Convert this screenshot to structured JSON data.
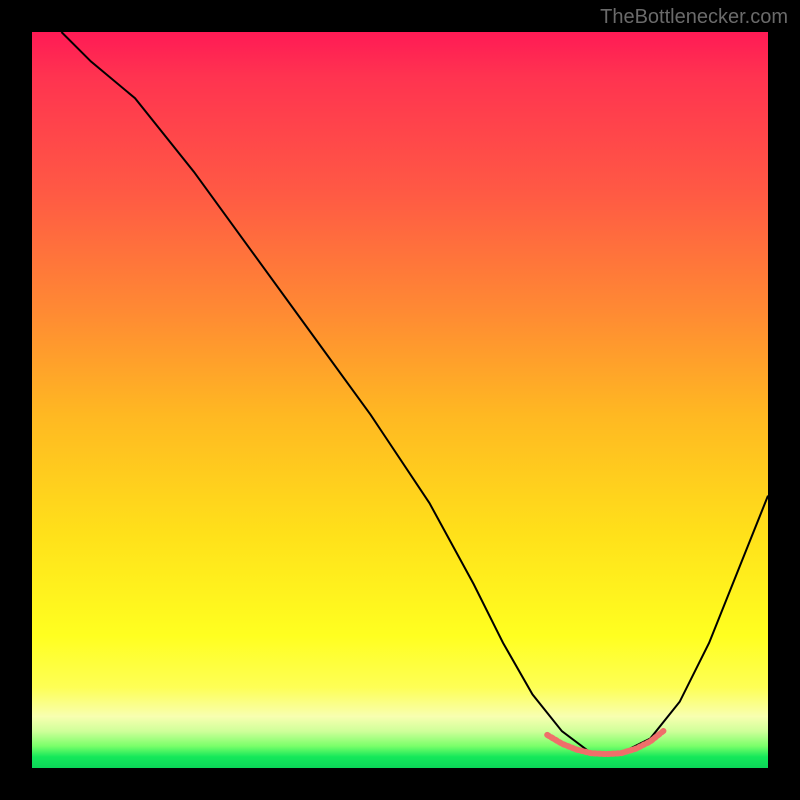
{
  "watermark": "TheBottlenecker.com",
  "chart_data": {
    "type": "line",
    "title": "",
    "xlabel": "",
    "ylabel": "",
    "xlim": [
      0,
      100
    ],
    "ylim": [
      0,
      100
    ],
    "series": [
      {
        "name": "curve",
        "x": [
          4,
          8,
          14,
          22,
          30,
          38,
          46,
          54,
          60,
          64,
          68,
          72,
          76,
          80,
          84,
          88,
          92,
          96,
          100
        ],
        "y": [
          100,
          96,
          91,
          81,
          70,
          59,
          48,
          36,
          25,
          17,
          10,
          5,
          2,
          2,
          4,
          9,
          17,
          27,
          37
        ]
      },
      {
        "name": "highlight",
        "color": "#ef6f6a",
        "x": [
          70,
          72,
          74,
          76,
          78,
          80,
          82,
          84,
          86
        ],
        "y": [
          4.5,
          3.3,
          2.5,
          2.0,
          1.9,
          2.0,
          2.6,
          3.6,
          5.2
        ]
      }
    ]
  }
}
